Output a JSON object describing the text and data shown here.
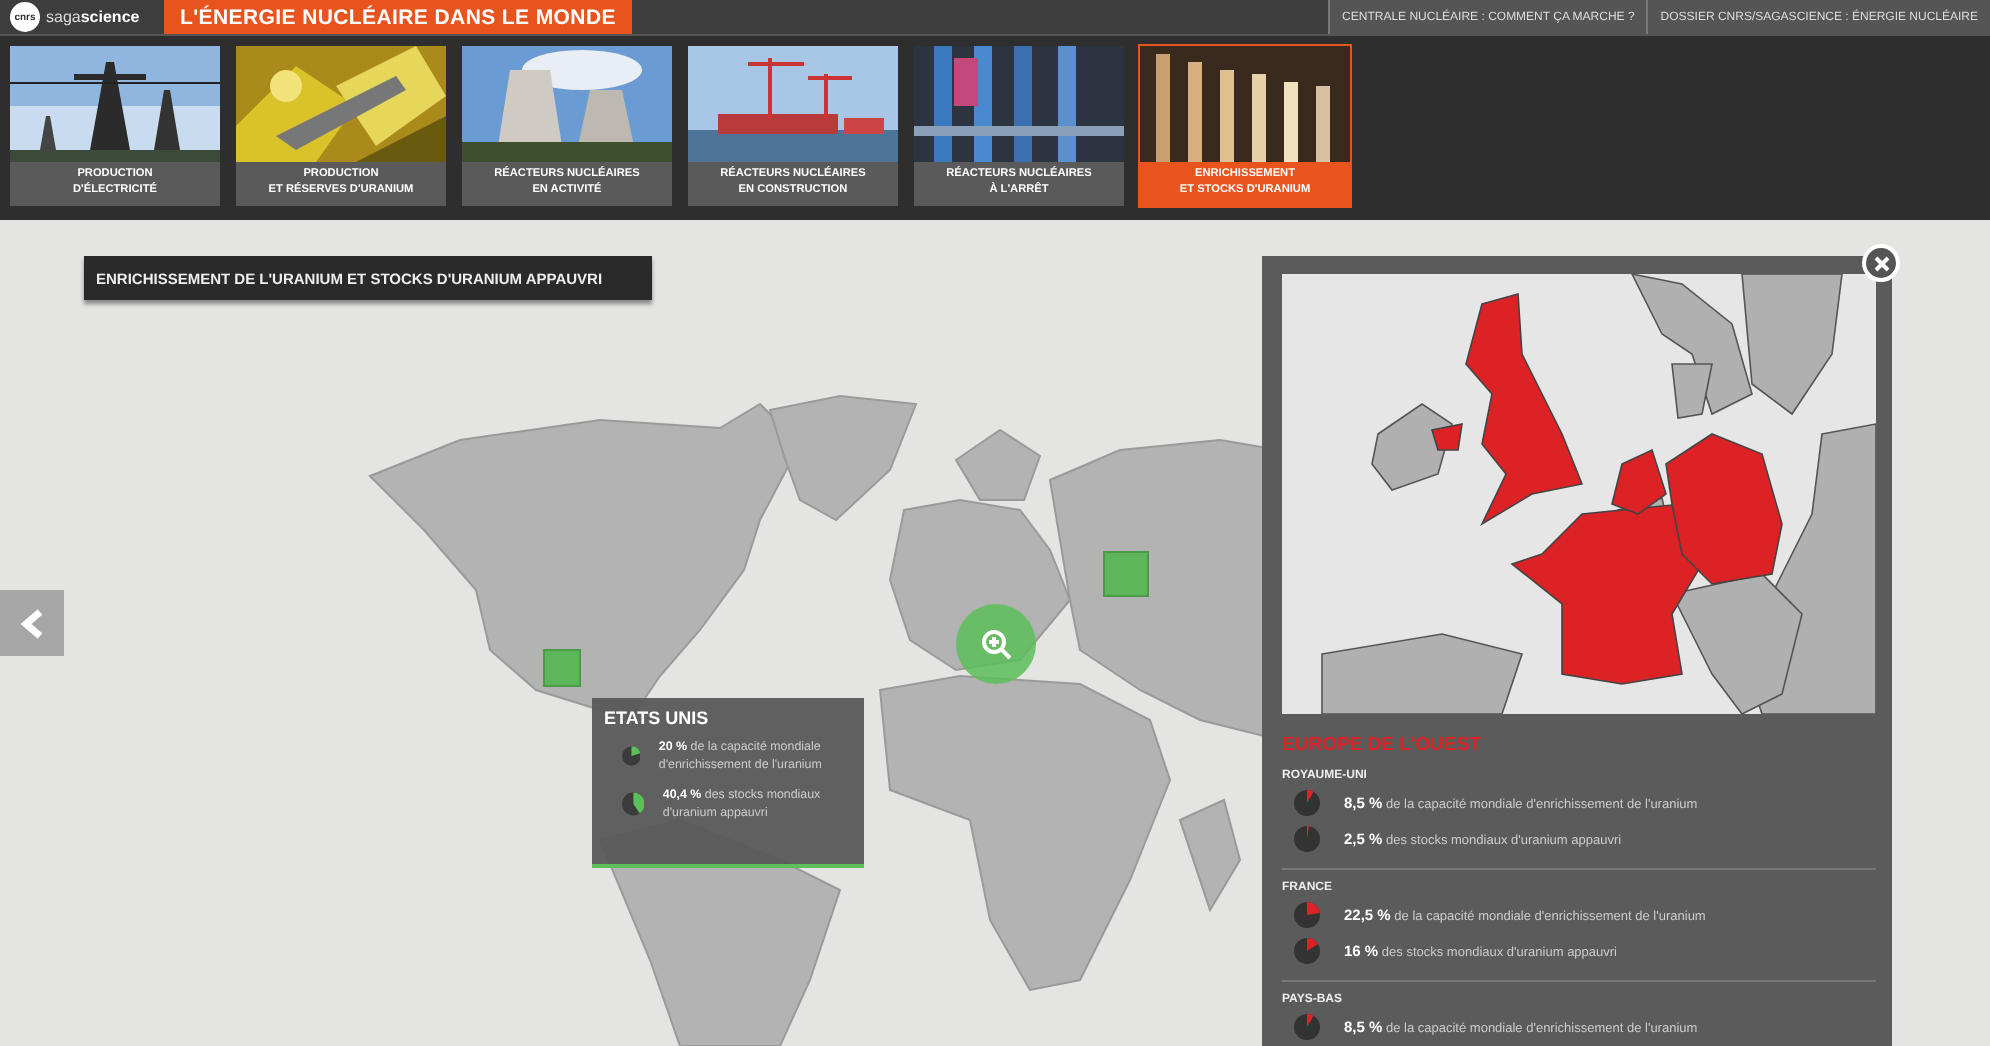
{
  "header": {
    "logo_mark": "cnrs",
    "logo_light": "saga",
    "logo_bold": "science",
    "title": "L'ÉNERGIE NUCLÉAIRE DANS LE MONDE",
    "links": [
      "CENTRALE NUCLÉAIRE : COMMENT ÇA MARCHE ?",
      "DOSSIER CNRS/SAGASCIENCE : ÉNERGIE NUCLÉAIRE"
    ]
  },
  "thumbnails": [
    {
      "kind": "pylons",
      "label": "PRODUCTION\nD'ÉLECTRICITÉ",
      "selected": false
    },
    {
      "kind": "crystals",
      "label": "PRODUCTION\nET RÉSERVES D'URANIUM",
      "selected": false
    },
    {
      "kind": "towers",
      "label": "RÉACTEURS NUCLÉAIRES\nEN ACTIVITÉ",
      "selected": false
    },
    {
      "kind": "cranes",
      "label": "RÉACTEURS NUCLÉAIRES\nEN CONSTRUCTION",
      "selected": false
    },
    {
      "kind": "pipes",
      "label": "RÉACTEURS NUCLÉAIRES\nÀ L'ARRÊT",
      "selected": false
    },
    {
      "kind": "tubes",
      "label": "ENRICHISSEMENT\nET STOCKS D'URANIUM",
      "selected": true
    }
  ],
  "section_title": "ENRICHISSEMENT DE L'URANIUM ET STOCKS D'URANIUM APPAUVRI",
  "tooltip": {
    "title": "ETATS UNIS",
    "stats": [
      {
        "value": "20 %",
        "text": "de la capacité mondiale d'enrichissement de l'uranium"
      },
      {
        "value": "40,4 %",
        "text": "des stocks mondiaux d'uranium appauvri"
      }
    ]
  },
  "panel": {
    "title": "EUROPE DE L'OUEST",
    "countries": [
      {
        "name": "ROYAUME-UNI",
        "stats": [
          {
            "value": "8,5 %",
            "text": "de la capacité mondiale d'enrichissement de l'uranium"
          },
          {
            "value": "2,5 %",
            "text": "des stocks mondiaux d'uranium appauvri"
          }
        ]
      },
      {
        "name": "FRANCE",
        "stats": [
          {
            "value": "22,5 %",
            "text": "de la capacité mondiale d'enrichissement de l'uranium"
          },
          {
            "value": "16 %",
            "text": "des stocks mondiaux d'uranium appauvri"
          }
        ]
      },
      {
        "name": "PAYS-BAS",
        "stats": [
          {
            "value": "8,5 %",
            "text": "de la capacité mondiale d'enrichissement de l'uranium"
          }
        ]
      }
    ]
  }
}
